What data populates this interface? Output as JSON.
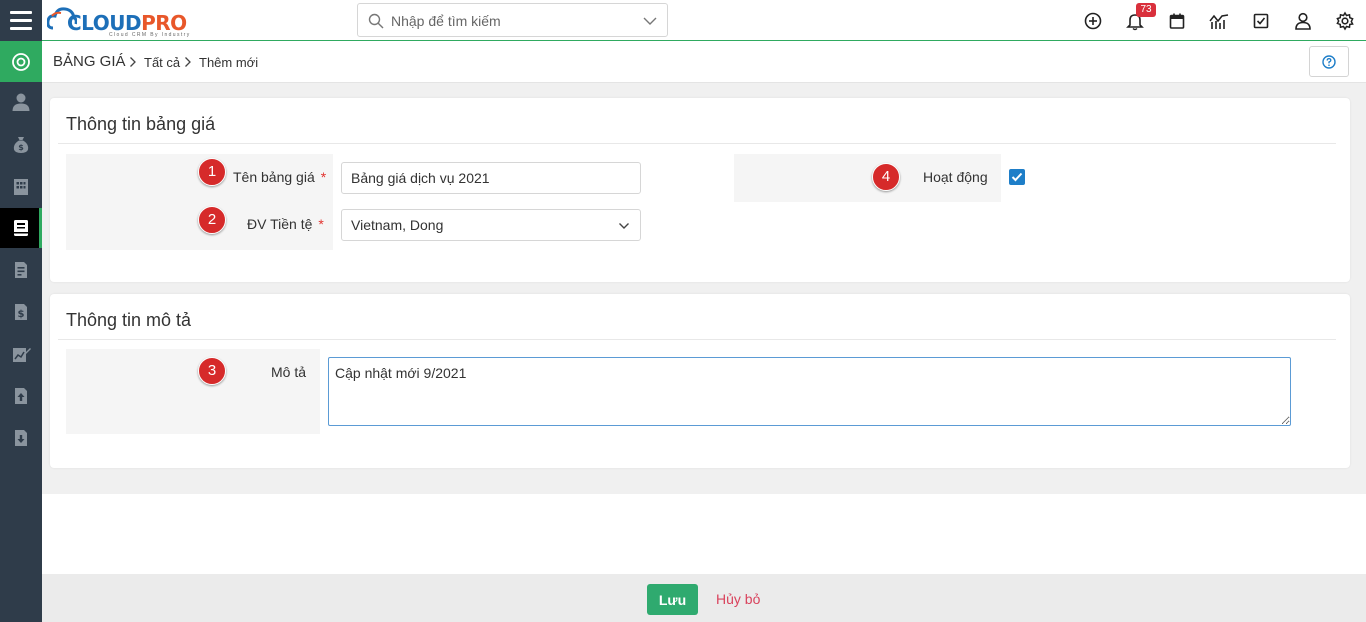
{
  "brand": {
    "name_part1": "CLOUD",
    "name_part2": "PRO",
    "tagline": "Cloud CRM By Industry"
  },
  "search": {
    "placeholder": "Nhập để tìm kiếm"
  },
  "topbar": {
    "icons": [
      "add-circle-icon",
      "bell-icon",
      "calendar-icon",
      "chart-icon",
      "checkbox-task-icon",
      "user-icon",
      "gear-icon"
    ],
    "notification_count": "73"
  },
  "sidebar": {
    "items": [
      "target-icon",
      "person-icon",
      "money-bag-icon",
      "building-icon",
      "book-icon",
      "invoice-icon",
      "receipt-dollar-icon",
      "chart-edit-icon",
      "upload-doc-icon",
      "download-doc-icon"
    ],
    "active_index": 4
  },
  "breadcrumb": {
    "root": "BẢNG GIÁ",
    "level1": "Tất cả",
    "level2": "Thêm mới"
  },
  "section_info": {
    "title": "Thông tin bảng giá",
    "name_label": "Tên bảng giá",
    "name_value": "Bảng giá dịch vụ 2021",
    "name_required": "*",
    "currency_label": "ĐV Tiền tệ",
    "currency_value": "Vietnam, Dong",
    "currency_required": "*",
    "active_label": "Hoạt động",
    "active_checked": true
  },
  "section_desc": {
    "title": "Thông tin mô tả",
    "desc_label": "Mô tả",
    "desc_value": "Cập nhật mới 9/2021"
  },
  "markers": [
    "1",
    "2",
    "3",
    "4"
  ],
  "footer": {
    "save_label": "Lưu",
    "cancel_label": "Hủy bỏ"
  },
  "colors": {
    "accent_green": "#2faa60",
    "sidebar_bg": "#2f3c4a",
    "marker_red": "#d62a2a",
    "checkbox_blue": "#1e7ec8",
    "cancel_red": "#d9435d"
  }
}
